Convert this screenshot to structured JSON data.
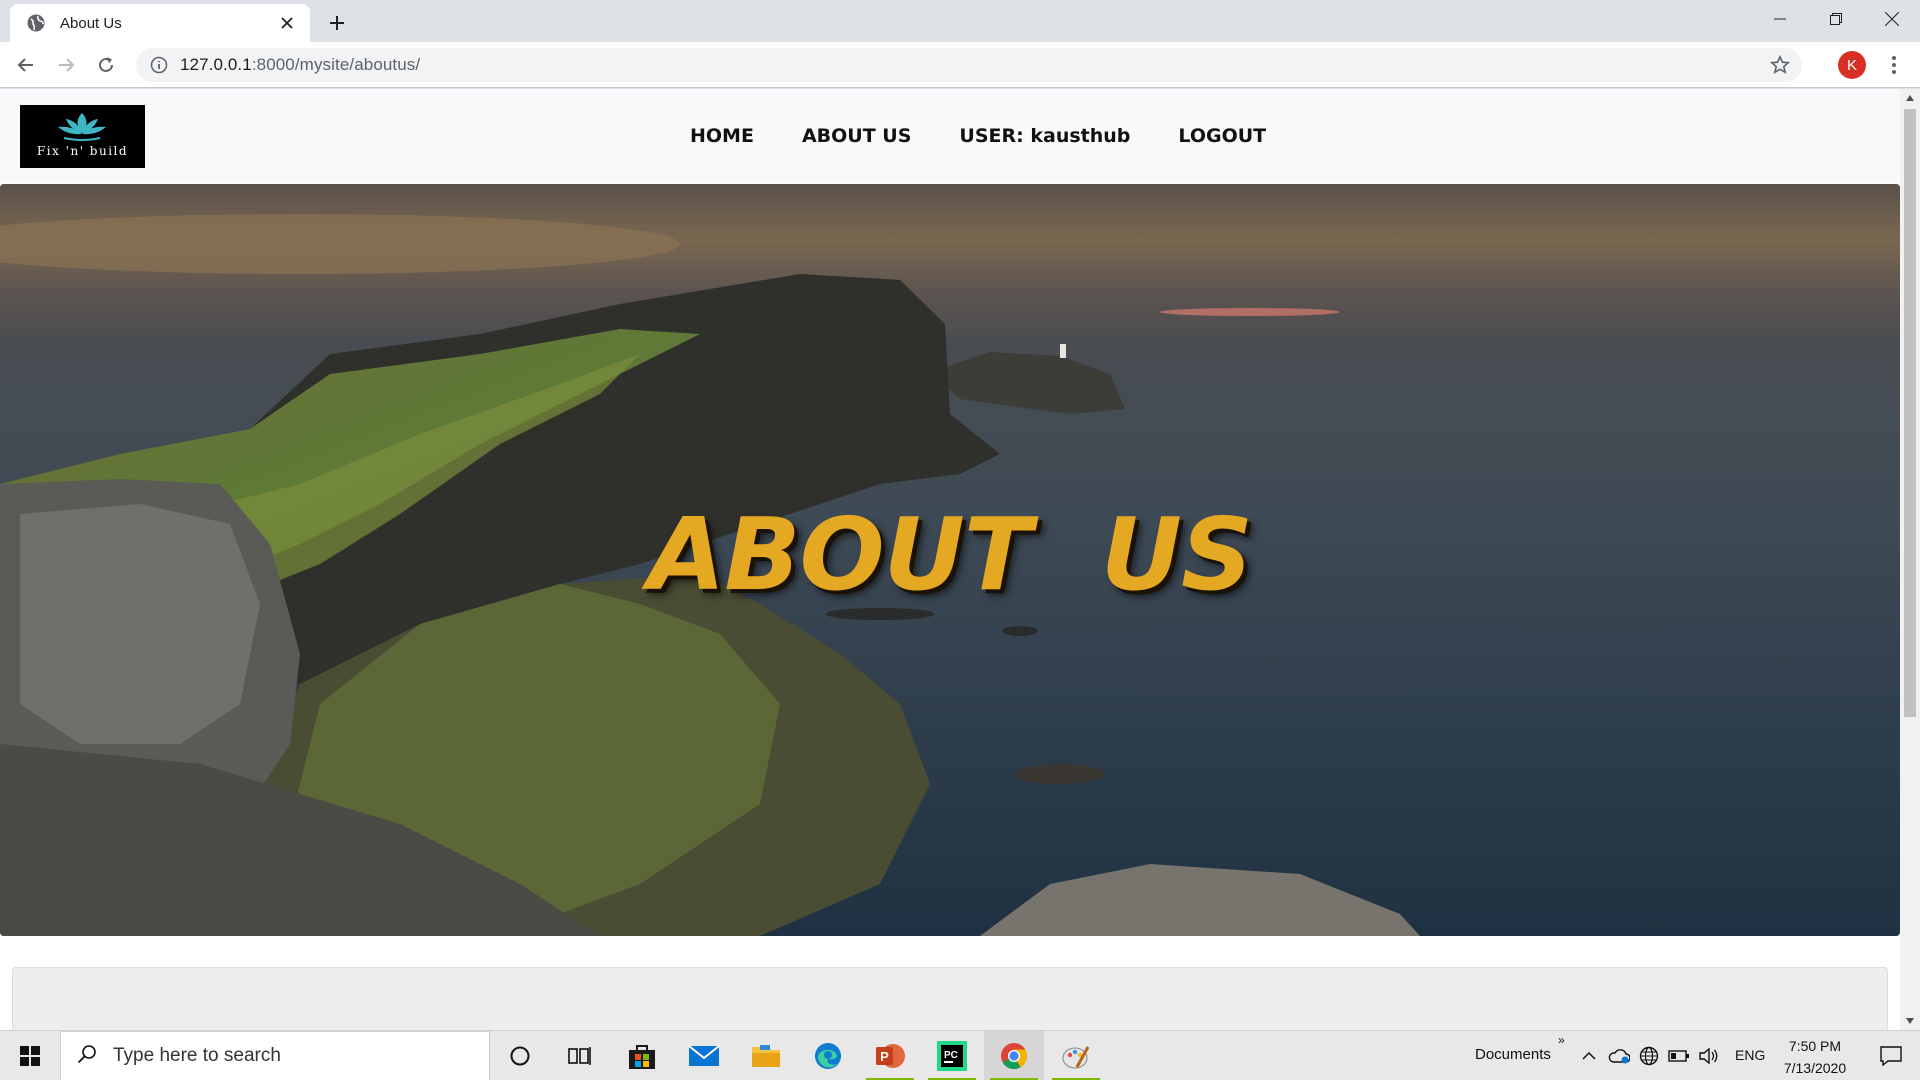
{
  "browser": {
    "tab_title": "About Us",
    "url_host": "127.0.0.1",
    "url_path": ":8000/mysite/aboutus/",
    "profile_initial": "K"
  },
  "site": {
    "logo_text": "Fix 'n' build",
    "nav": [
      {
        "label": "HOME"
      },
      {
        "label": "ABOUT US"
      },
      {
        "label": "USER: kausthub"
      },
      {
        "label": "LOGOUT"
      }
    ],
    "hero_title": "ABOUT US",
    "colors": {
      "hero_title": "#e5a822",
      "logo_icon": "#3fb6c4",
      "navbar_bg": "#f8f9fa"
    }
  },
  "taskbar": {
    "search_placeholder": "Type here to search",
    "toolbar_label": "Documents",
    "language": "ENG",
    "time": "7:50 PM",
    "date": "7/13/2020",
    "apps": [
      "task-view",
      "store",
      "mail",
      "file-explorer",
      "edge",
      "powerpoint",
      "pycharm",
      "chrome",
      "paint"
    ]
  }
}
